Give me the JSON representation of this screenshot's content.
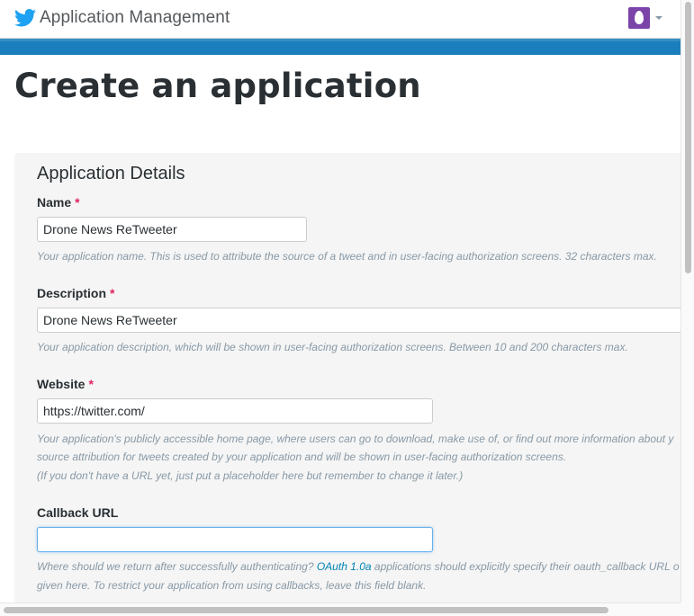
{
  "header": {
    "app_title": "Application Management",
    "logo_icon": "twitter-bird-icon",
    "avatar_icon": "egg-avatar-icon",
    "menu_icon": "caret-down-icon",
    "brand_color": "#1da1f2",
    "bar_color": "#1b7fbd"
  },
  "page": {
    "title": "Create an application"
  },
  "form": {
    "section_title": "Application Details",
    "required_mark": "*",
    "name": {
      "label": "Name",
      "value": "Drone News ReTweeter",
      "help": "Your application name. This is used to attribute the source of a tweet and in user-facing authorization screens. 32 characters max."
    },
    "description": {
      "label": "Description",
      "value": "Drone News ReTweeter",
      "help": "Your application description, which will be shown in user-facing authorization screens. Between 10 and 200 characters max."
    },
    "website": {
      "label": "Website",
      "value": "https://twitter.com/",
      "help_line1": "Your application's publicly accessible home page, where users can go to download, make use of, or find out more information about y",
      "help_line2": "source attribution for tweets created by your application and will be shown in user-facing authorization screens.",
      "help_line3": "(If you don't have a URL yet, just put a placeholder here but remember to change it later.)"
    },
    "callback": {
      "label": "Callback URL",
      "value": "",
      "help_prefix": "Where should we return after successfully authenticating?",
      "help_link": "OAuth 1.0a",
      "help_suffix": "applications should explicitly specify their oauth_callback URL o",
      "help_line2": "given here. To restrict your application from using callbacks, leave this field blank."
    }
  }
}
